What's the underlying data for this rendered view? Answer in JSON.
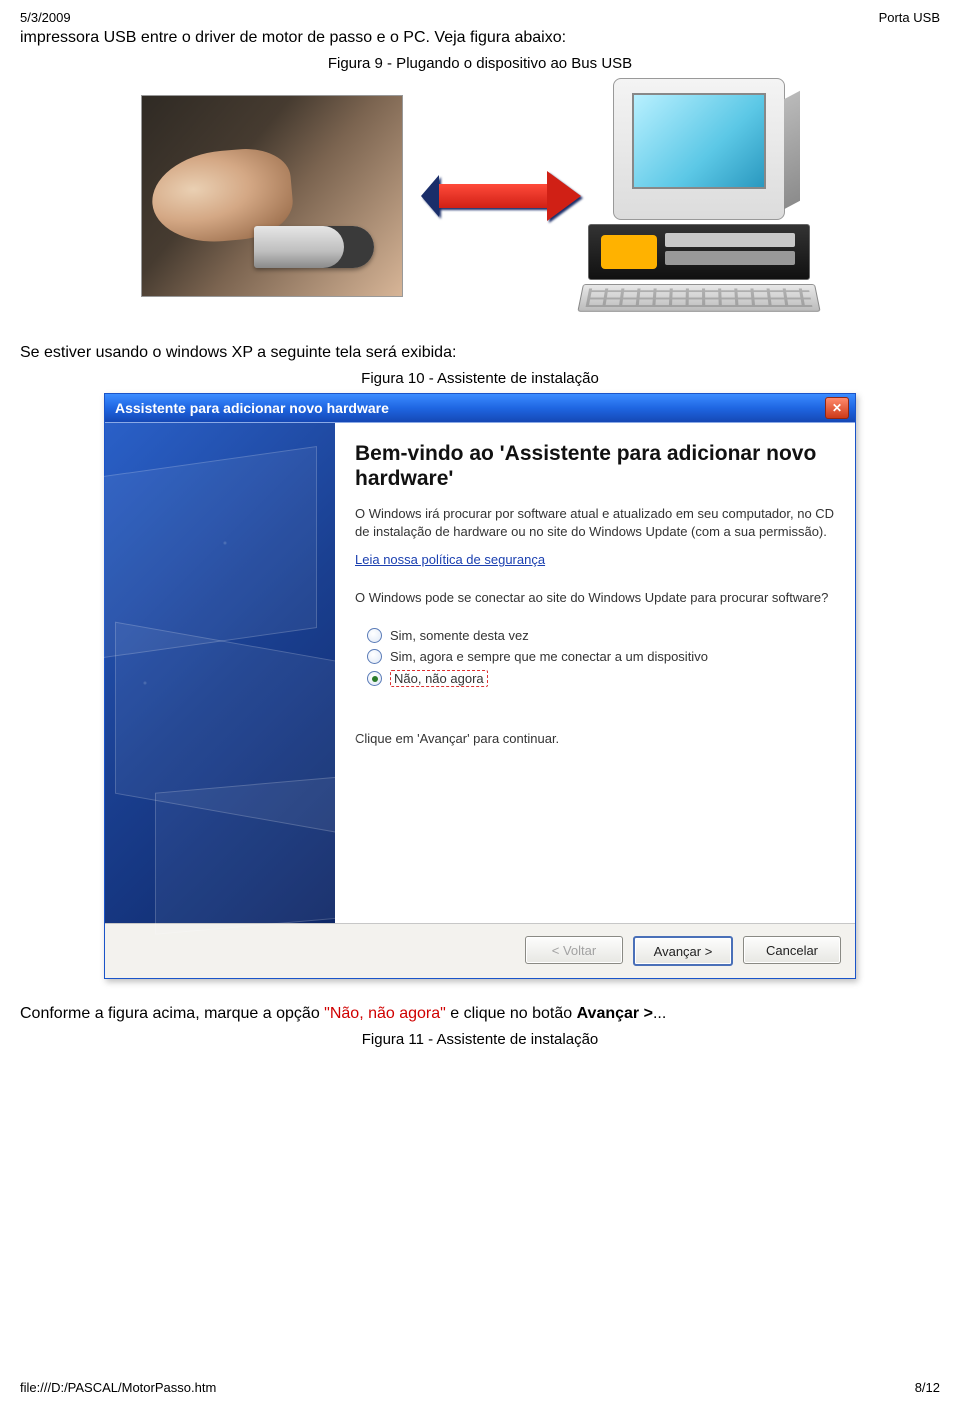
{
  "header": {
    "date": "5/3/2009",
    "title": "Porta USB"
  },
  "intro": {
    "text": "impressora USB entre o driver de motor de passo e o PC. Veja figura abaixo:"
  },
  "fig9_caption": "Figura 9 - Plugando o dispositivo ao Bus USB",
  "para1": "Se estiver usando o windows XP a seguinte tela será exibida:",
  "fig10_caption": "Figura 10 - Assistente de instalação",
  "wizard": {
    "titlebar": "Assistente para adicionar novo hardware",
    "welcome_title": "Bem-vindo ao 'Assistente para adicionar novo hardware'",
    "desc": "O Windows irá procurar por software atual e atualizado em seu computador, no CD de instalação de hardware ou no site do Windows Update (com a sua permissão).",
    "policy_link": "Leia nossa política de segurança",
    "question": "O Windows pode se conectar ao site do Windows Update para procurar software?",
    "options": [
      {
        "label": "Sim, somente desta vez",
        "selected": false,
        "highlight": false
      },
      {
        "label": "Sim, agora e sempre que me conectar a um dispositivo",
        "selected": false,
        "highlight": false
      },
      {
        "label": "Não, não agora",
        "selected": true,
        "highlight": true
      }
    ],
    "continue_hint": "Clique em 'Avançar' para continuar.",
    "buttons": {
      "back": "< Voltar",
      "next": "Avançar >",
      "cancel": "Cancelar"
    }
  },
  "post": {
    "pre": "Conforme a figura acima, marque a opção ",
    "red": "\"Não, não agora\"",
    "mid": " e clique no botão ",
    "bold": "Avançar >",
    "after": "..."
  },
  "fig11_caption": "Figura 11 - Assistente de instalação",
  "footer": {
    "path": "file:///D:/PASCAL/MotorPasso.htm",
    "page": "8/12"
  }
}
